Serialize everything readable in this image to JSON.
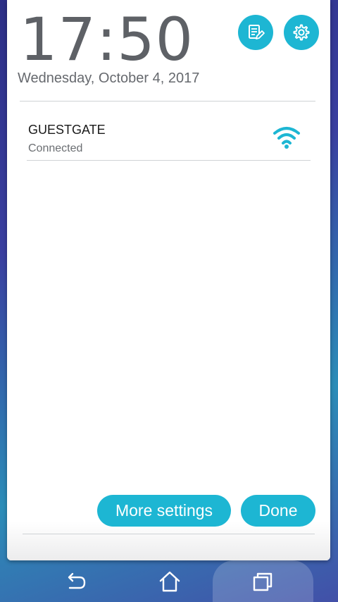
{
  "lockscreen": {
    "time": "17:50",
    "date": "Wednesday, October 4, 2017"
  },
  "actions": {
    "edit_icon": "notes-edit-icon",
    "settings_icon": "gear-icon"
  },
  "wifi": {
    "network_name": "GUESTGATE",
    "status": "Connected",
    "icon": "wifi-signal-icon"
  },
  "buttons": {
    "more_settings": "More settings",
    "done": "Done"
  },
  "navbar": {
    "back_icon": "back-icon",
    "home_icon": "home-icon",
    "recent_icon": "recent-apps-icon"
  },
  "colors": {
    "accent": "#1db6d3",
    "panel": "#ffffff",
    "text_dark": "#1a1a1a",
    "text_muted": "#6b6e72"
  }
}
